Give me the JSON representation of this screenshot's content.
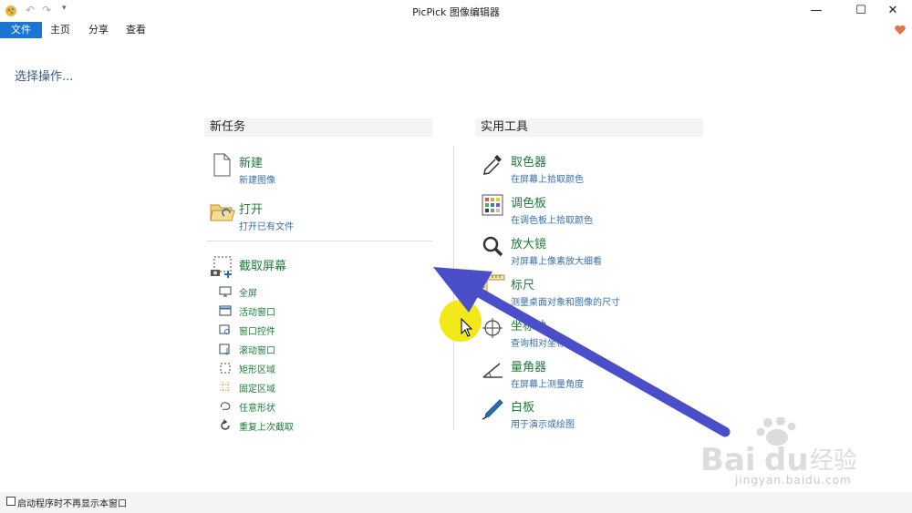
{
  "window": {
    "title": "PicPick 图像编辑器",
    "minimize": "—",
    "maximize": "☐",
    "close": "✕"
  },
  "menu": [
    "文件",
    "主页",
    "分享",
    "查看"
  ],
  "subtitle": "选择操作...",
  "new_task": {
    "heading": "新任务",
    "items": [
      {
        "title": "新建",
        "desc": "新建图像",
        "icon": "new-file-icon"
      },
      {
        "title": "打开",
        "desc": "打开已有文件",
        "icon": "open-folder-icon"
      }
    ],
    "capture": {
      "title": "截取屏幕",
      "icon": "screen-capture-icon",
      "items": [
        "全屏",
        "活动窗口",
        "窗口控件",
        "滚动窗口",
        "矩形区域",
        "固定区域",
        "任意形状",
        "重复上次截取"
      ]
    }
  },
  "tools": {
    "heading": "实用工具",
    "items": [
      {
        "title": "取色器",
        "desc": "在屏幕上拾取颜色",
        "icon": "eyedropper-icon"
      },
      {
        "title": "调色板",
        "desc": "在调色板上拾取颜色",
        "icon": "palette-icon"
      },
      {
        "title": "放大镜",
        "desc": "对屏幕上像素放大细看",
        "icon": "magnifier-icon"
      },
      {
        "title": "标尺",
        "desc": "测量桌面对象和图像的尺寸",
        "icon": "ruler-icon"
      },
      {
        "title": "坐标轴",
        "desc": "查询相对坐标",
        "icon": "crosshair-icon"
      },
      {
        "title": "量角器",
        "desc": "在屏幕上测量角度",
        "icon": "protractor-icon"
      },
      {
        "title": "白板",
        "desc": "用于演示或绘图",
        "icon": "whiteboard-pen-icon"
      }
    ]
  },
  "statusbar": {
    "checkbox_label": "启动程序时不再显示本窗口",
    "checked": false
  },
  "watermark": {
    "main": "Bai du 经验",
    "url": "jingyan.baidu.com"
  },
  "colors": {
    "accent": "#1976d2",
    "title_green": "#1e7b3a",
    "desc_blue": "#3a6ea5",
    "arrow": "#4a4fc9",
    "cursor_highlight": "#f2e600"
  }
}
